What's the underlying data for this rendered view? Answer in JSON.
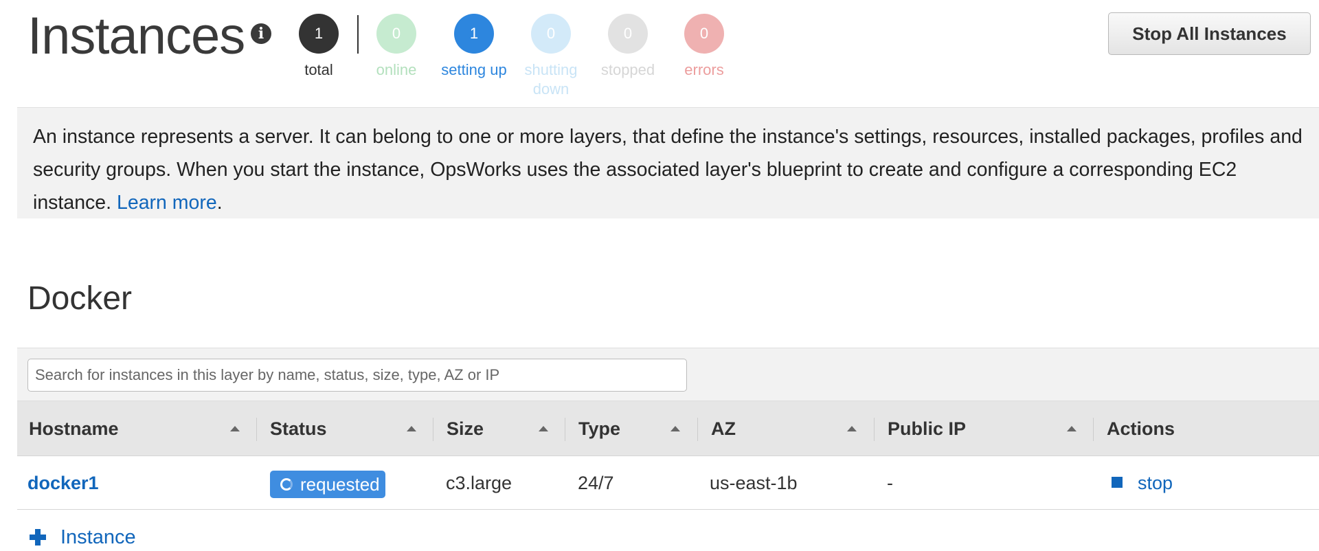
{
  "header": {
    "title": "Instances",
    "info_icon": "info-circle-icon",
    "counters": [
      {
        "key": "total",
        "count": "1",
        "label": "total",
        "circle_color": "#333333",
        "label_color": "#333333"
      },
      {
        "key": "online",
        "count": "0",
        "label": "online",
        "circle_color": "#c6ebd0",
        "label_color": "#b3e0bd"
      },
      {
        "key": "setting-up",
        "count": "1",
        "label": "setting up",
        "circle_color": "#2d86de",
        "label_color": "#2d86de"
      },
      {
        "key": "shutting-down",
        "count": "0",
        "label": "shutting down",
        "circle_color": "#d3eaf9",
        "label_color": "#c9e4f6"
      },
      {
        "key": "stopped",
        "count": "0",
        "label": "stopped",
        "circle_color": "#e2e2e2",
        "label_color": "#d6d6d6"
      },
      {
        "key": "errors",
        "count": "0",
        "label": "errors",
        "circle_color": "#efb1b1",
        "label_color": "#ec9d9d"
      }
    ],
    "stop_all_label": "Stop All Instances"
  },
  "info": {
    "text": "An instance represents a server. It can belong to one or more layers, that define the instance's settings, resources, installed packages, profiles and security groups. When you start the instance, OpsWorks uses the associated layer's blueprint to create and configure a corresponding EC2 instance. ",
    "link_label": "Learn more",
    "suffix": "."
  },
  "layer": {
    "title": "Docker",
    "search_placeholder": "Search for instances in this layer by name, status, size, type, AZ or IP",
    "columns": [
      "Hostname",
      "Status",
      "Size",
      "Type",
      "AZ",
      "Public IP",
      "Actions"
    ],
    "sort_icon": "sort-asc-icon",
    "rows": [
      {
        "hostname": "docker1",
        "status": "requested",
        "status_icon": "spinner-icon",
        "size": "c3.large",
        "type": "24/7",
        "az": "us-east-1b",
        "public_ip": "-",
        "action_label": "stop",
        "action_icon": "stop-square-icon"
      }
    ],
    "add_label": "Instance",
    "add_icon": "plus-icon"
  },
  "colors": {
    "link": "#1166bb",
    "status_badge": "#3f8de0",
    "panel_bg": "#f2f2f2",
    "header_bg": "#e6e6e6"
  }
}
